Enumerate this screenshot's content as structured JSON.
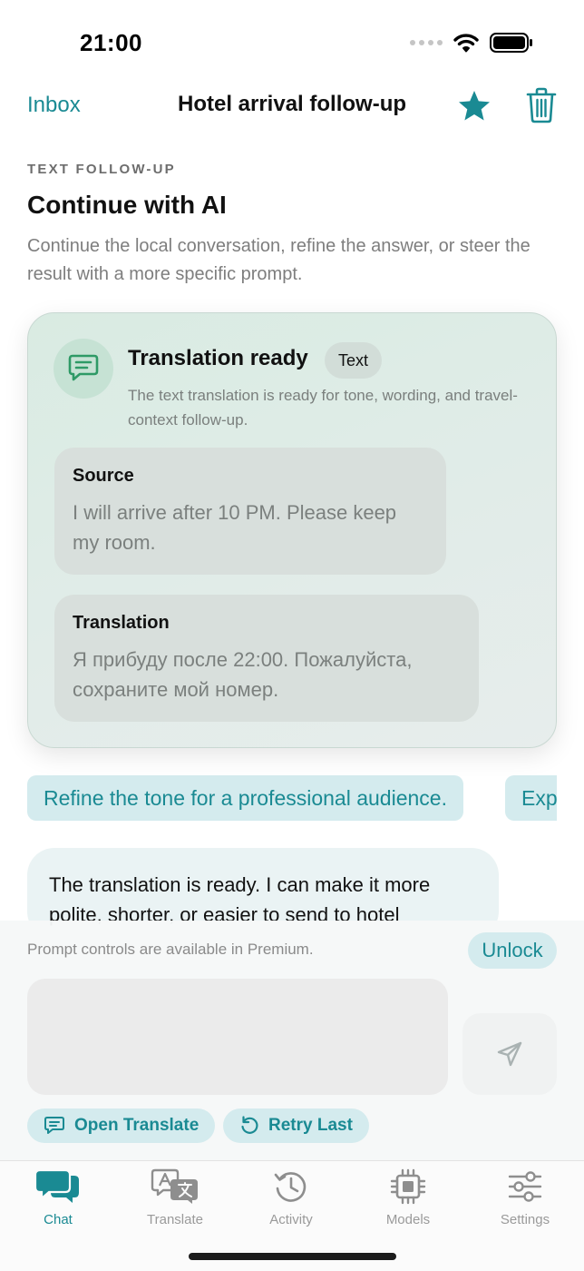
{
  "status": {
    "time": "21:00"
  },
  "nav": {
    "back_label": "Inbox",
    "title": "Hotel arrival follow-up",
    "star_icon": "star-icon",
    "trash_icon": "trash-icon"
  },
  "header": {
    "eyebrow": "TEXT FOLLOW-UP",
    "title": "Continue with AI",
    "subtitle": "Continue the local conversation, refine the answer, or steer the result with a more specific prompt."
  },
  "card": {
    "icon": "message-icon",
    "title": "Translation ready",
    "badge": "Text",
    "description": "The text translation is ready for tone, wording, and travel-context follow-up.",
    "source_label": "Source",
    "source_text": "I will arrive after 10 PM. Please keep my room.",
    "translation_label": "Translation",
    "translation_text": "Я прибуду после 22:00. Пожалуйста, сохраните мой номер."
  },
  "suggestions": [
    "Refine the tone for a professional audience.",
    "Exp"
  ],
  "assistant_message": "The translation is ready. I can make it more polite, shorter, or easier to send to hotel",
  "composer": {
    "premium_note": "Prompt controls are available in Premium.",
    "unlock_label": "Unlock",
    "prompt_placeholder": "",
    "send_icon": "send-icon",
    "open_translate_label": "Open Translate",
    "retry_label": "Retry Last"
  },
  "tabs": [
    {
      "label": "Chat",
      "icon": "chat-icon",
      "active": true
    },
    {
      "label": "Translate",
      "icon": "translate-icon",
      "active": false
    },
    {
      "label": "Activity",
      "icon": "history-icon",
      "active": false
    },
    {
      "label": "Models",
      "icon": "chip-icon",
      "active": false
    },
    {
      "label": "Settings",
      "icon": "sliders-icon",
      "active": false
    }
  ],
  "colors": {
    "accent": "#1a8a93",
    "card_background": "#dcebe4",
    "chip_background": "#d4ebee"
  }
}
